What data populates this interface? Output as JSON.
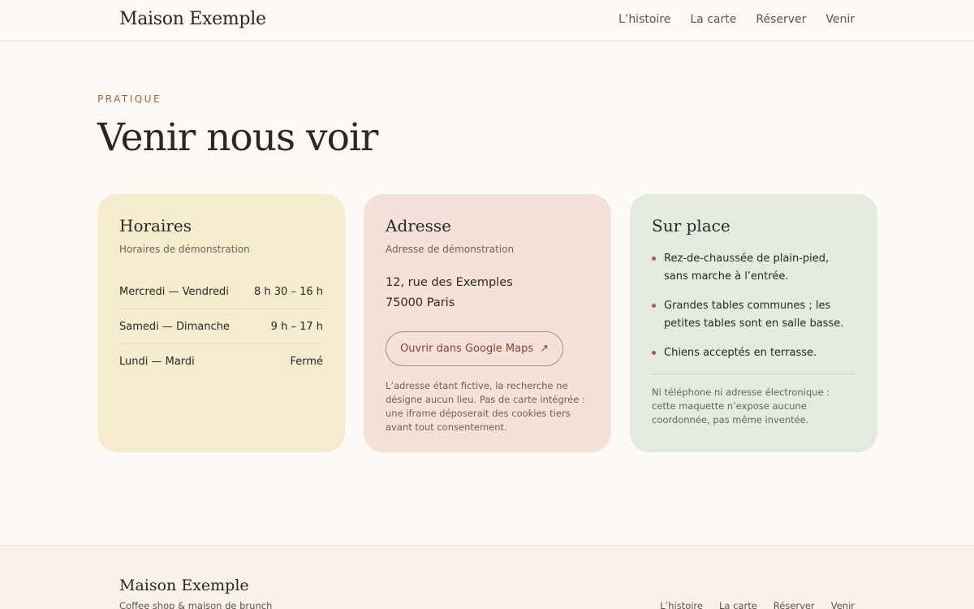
{
  "header": {
    "brand": "Maison Exemple",
    "nav": [
      "L’histoire",
      "La carte",
      "Réserver",
      "Venir"
    ]
  },
  "hero": {
    "eyebrow": "PRATIQUE",
    "title": "Venir nous voir"
  },
  "hours": {
    "title": "Horaires",
    "subtitle": "Horaires de démonstration",
    "rows": [
      {
        "days": "Mercredi — Vendredi",
        "time": "8 h 30 – 16 h"
      },
      {
        "days": "Samedi — Dimanche",
        "time": "9 h – 17 h"
      },
      {
        "days": "Lundi — Mardi",
        "time": "Fermé"
      }
    ]
  },
  "address": {
    "title": "Adresse",
    "subtitle": "Adresse de démonstration",
    "line1": "12, rue des Exemples",
    "line2": "75000 Paris",
    "maps_label": "Ouvrir dans Google Maps",
    "maps_icon": "↗",
    "note": "L’adresse étant fictive, la recherche ne désigne aucun lieu. Pas de carte intégrée : une iframe déposerait des cookies tiers avant tout consentement."
  },
  "onsite": {
    "title": "Sur place",
    "items": [
      "Rez-de-chaussée de plain-pied, sans marche à l’entrée.",
      "Grandes tables communes ; les petites tables sont en salle basse.",
      "Chiens acceptés en terrasse."
    ],
    "note": "Ni téléphone ni adresse électronique : cette maquette n’expose aucune coordonnée, pas même inventée."
  },
  "footer": {
    "brand": "Maison Exemple",
    "tagline": "Coffee shop & maison de brunch",
    "nav": [
      "L’histoire",
      "La carte",
      "Réserver",
      "Venir"
    ]
  },
  "colors": {
    "background": "#fdfaf6",
    "accent": "#a85a44",
    "hours_card": "#f7ebcf",
    "address_card": "#f4e2da",
    "onsite_card": "#e3ebe0"
  }
}
